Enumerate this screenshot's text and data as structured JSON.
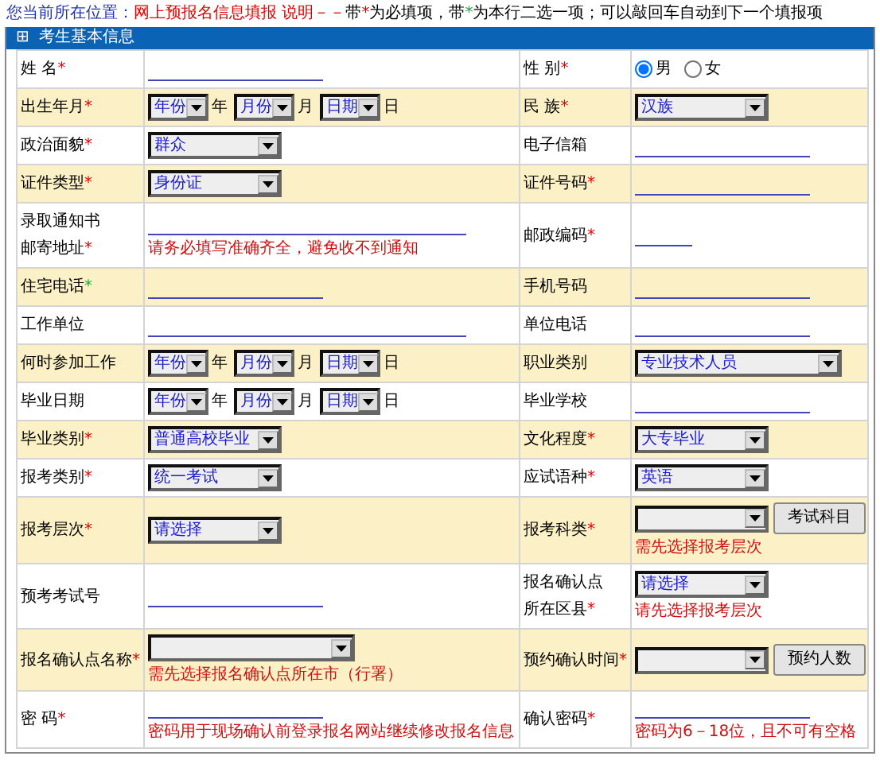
{
  "notice": [
    {
      "text": "您当前所在位置：",
      "color": "#2233aa"
    },
    {
      "text": "网上预报名信息填报  说明－－",
      "color": "#e00000"
    },
    {
      "text": "带",
      "color": "#000000"
    },
    {
      "text": "*",
      "color": "#e00000"
    },
    {
      "text": "为必填项，带",
      "color": "#000000"
    },
    {
      "text": "*",
      "color": "#1aa83a"
    },
    {
      "text": "为本行二选一项；可以敲回车自动到下一个填报项",
      "color": "#000000"
    }
  ],
  "section": {
    "icon": "⊞",
    "title": "考生基本信息"
  },
  "rows": [
    {
      "shaded": false,
      "cells": [
        {
          "label": [
            "姓  名"
          ],
          "marker": {
            "text": "*",
            "color": "#e00000"
          },
          "field": {
            "kind": "line"
          }
        },
        {
          "label": [
            "性  别"
          ],
          "marker": {
            "text": "*",
            "color": "#e00000"
          },
          "field": {
            "kind": "radio",
            "options": [
              {
                "label": "男",
                "selected": true
              },
              {
                "label": "女",
                "selected": false
              }
            ]
          }
        }
      ]
    },
    {
      "shaded": true,
      "cells": [
        {
          "label": [
            "出生年月"
          ],
          "marker": {
            "text": "*",
            "color": "#e00000"
          },
          "field": {
            "kind": "date",
            "parts": [
              {
                "value": "年份",
                "unit": "年"
              },
              {
                "value": "月份",
                "unit": "月"
              },
              {
                "value": "日期",
                "unit": "日"
              }
            ]
          }
        },
        {
          "label": [
            "民  族"
          ],
          "marker": {
            "text": "*",
            "color": "#e00000"
          },
          "field": {
            "kind": "select",
            "value": "汉族"
          }
        }
      ]
    },
    {
      "shaded": false,
      "cells": [
        {
          "label": [
            "政治面貌"
          ],
          "marker": {
            "text": "*",
            "color": "#e00000"
          },
          "field": {
            "kind": "select",
            "value": "群众"
          }
        },
        {
          "label": [
            "电子信箱"
          ],
          "field": {
            "kind": "line"
          }
        }
      ]
    },
    {
      "shaded": true,
      "cells": [
        {
          "label": [
            "证件类型"
          ],
          "marker": {
            "text": "*",
            "color": "#e00000"
          },
          "field": {
            "kind": "select",
            "value": "身份证"
          }
        },
        {
          "label": [
            "证件号码"
          ],
          "marker": {
            "text": "*",
            "color": "#e00000"
          },
          "field": {
            "kind": "line"
          }
        }
      ]
    },
    {
      "shaded": false,
      "cells": [
        {
          "label": [
            "录取通知书",
            "邮寄地址"
          ],
          "marker": {
            "text": "*",
            "color": "#e00000"
          },
          "field": {
            "kind": "long_line",
            "note": "请务必填写准确齐全，避免收不到通知"
          }
        },
        {
          "label": [
            "邮政编码"
          ],
          "marker": {
            "text": "*",
            "color": "#e00000"
          },
          "field": {
            "kind": "short_line"
          }
        }
      ]
    },
    {
      "shaded": true,
      "cells": [
        {
          "label": [
            "住宅电话"
          ],
          "marker": {
            "text": "*",
            "color": "#1aa83a"
          },
          "field": {
            "kind": "line"
          }
        },
        {
          "label": [
            "手机号码"
          ],
          "field": {
            "kind": "line"
          }
        }
      ]
    },
    {
      "shaded": false,
      "cells": [
        {
          "label": [
            "工作单位"
          ],
          "field": {
            "kind": "long_line"
          }
        },
        {
          "label": [
            "单位电话"
          ],
          "field": {
            "kind": "line"
          }
        }
      ]
    },
    {
      "shaded": true,
      "cells": [
        {
          "label": [
            "何时参加工作"
          ],
          "field": {
            "kind": "date",
            "parts": [
              {
                "value": "年份",
                "unit": "年"
              },
              {
                "value": "月份",
                "unit": "月"
              },
              {
                "value": "日期",
                "unit": "日"
              }
            ]
          }
        },
        {
          "label": [
            "职业类别"
          ],
          "field": {
            "kind": "long_select",
            "value": "专业技术人员"
          }
        }
      ]
    },
    {
      "shaded": false,
      "cells": [
        {
          "label": [
            "毕业日期"
          ],
          "field": {
            "kind": "date",
            "parts": [
              {
                "value": "年份",
                "unit": "年"
              },
              {
                "value": "月份",
                "unit": "月"
              },
              {
                "value": "日期",
                "unit": "日"
              }
            ]
          }
        },
        {
          "label": [
            "毕业学校"
          ],
          "field": {
            "kind": "line"
          }
        }
      ]
    },
    {
      "shaded": true,
      "cells": [
        {
          "label": [
            "毕业类别"
          ],
          "marker": {
            "text": "*",
            "color": "#e00000"
          },
          "field": {
            "kind": "select",
            "value": "普通高校毕业"
          }
        },
        {
          "label": [
            "文化程度"
          ],
          "marker": {
            "text": "*",
            "color": "#e00000"
          },
          "field": {
            "kind": "select",
            "value": "大专毕业"
          }
        }
      ]
    },
    {
      "shaded": false,
      "cells": [
        {
          "label": [
            "报考类别"
          ],
          "marker": {
            "text": "*",
            "color": "#e00000"
          },
          "field": {
            "kind": "select",
            "value": "统一考试"
          }
        },
        {
          "label": [
            "应试语种"
          ],
          "marker": {
            "text": "*",
            "color": "#e00000"
          },
          "field": {
            "kind": "select",
            "value": "英语"
          }
        }
      ]
    },
    {
      "shaded": true,
      "cells": [
        {
          "label": [
            "报考层次"
          ],
          "marker": {
            "text": "*",
            "color": "#e00000"
          },
          "field": {
            "kind": "select",
            "value": "请选择"
          }
        },
        {
          "label": [
            "报考科类"
          ],
          "marker": {
            "text": "*",
            "color": "#e00000"
          },
          "field": {
            "kind": "select",
            "button": "考试科目",
            "note": "需先选择报考层次"
          }
        }
      ]
    },
    {
      "shaded": false,
      "cells": [
        {
          "label": [
            "预考考试号"
          ],
          "field": {
            "kind": "line"
          }
        },
        {
          "label": [
            "报名确认点",
            "所在区县"
          ],
          "marker": {
            "text": "*",
            "color": "#e00000"
          },
          "field": {
            "kind": "select",
            "value": "请选择",
            "note": "请先选择报考层次"
          }
        }
      ]
    },
    {
      "shaded": true,
      "cells": [
        {
          "label": [
            "报名确认点名称"
          ],
          "marker": {
            "text": "*",
            "color": "#e00000"
          },
          "field": {
            "kind": "long_select",
            "note": "需先选择报名确认点所在市（行署）"
          }
        },
        {
          "label": [
            "预约确认时间"
          ],
          "marker": {
            "text": "*",
            "color": "#e00000"
          },
          "field": {
            "kind": "select",
            "button": "预约人数"
          }
        }
      ]
    },
    {
      "shaded": false,
      "cells": [
        {
          "label": [
            "密  码"
          ],
          "marker": {
            "text": "*",
            "color": "#e00000"
          },
          "field": {
            "kind": "line",
            "note": "密码用于现场确认前登录报名网站继续修改报名信息"
          }
        },
        {
          "label": [
            "确认密码"
          ],
          "marker": {
            "text": "*",
            "color": "#e00000"
          },
          "field": {
            "kind": "line",
            "note": "密码为6－18位，且不可有空格"
          }
        }
      ]
    }
  ]
}
